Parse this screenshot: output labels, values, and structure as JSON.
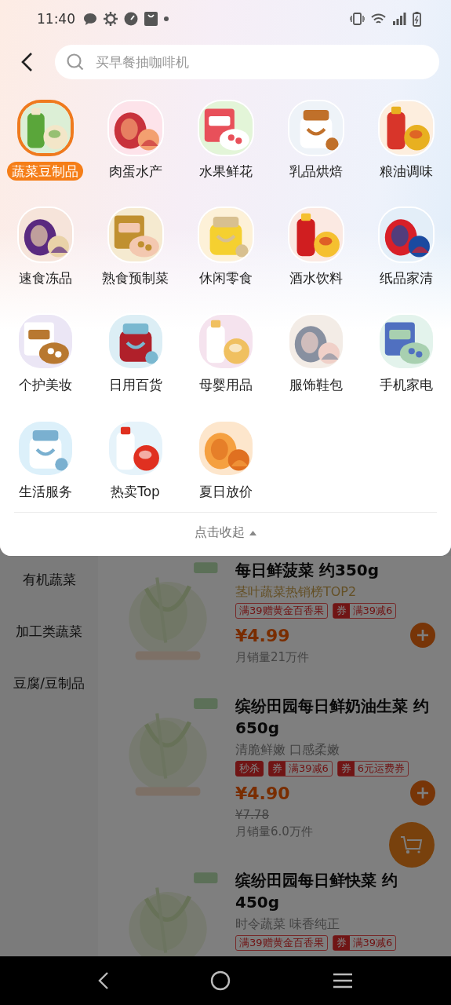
{
  "status_bar": {
    "time": "11:40"
  },
  "search": {
    "placeholder": "买早餐抽咖啡机"
  },
  "categories": [
    {
      "label": "蔬菜豆制品",
      "selected": true
    },
    {
      "label": "肉蛋水产",
      "selected": false
    },
    {
      "label": "水果鲜花",
      "selected": false
    },
    {
      "label": "乳品烘焙",
      "selected": false
    },
    {
      "label": "粮油调味",
      "selected": false
    },
    {
      "label": "速食冻品",
      "selected": false
    },
    {
      "label": "熟食预制菜",
      "selected": false
    },
    {
      "label": "休闲零食",
      "selected": false
    },
    {
      "label": "酒水饮料",
      "selected": false
    },
    {
      "label": "纸品家清",
      "selected": false
    },
    {
      "label": "个护美妆",
      "selected": false
    },
    {
      "label": "日用百货",
      "selected": false
    },
    {
      "label": "母婴用品",
      "selected": false
    },
    {
      "label": "服饰鞋包",
      "selected": false
    },
    {
      "label": "手机家电",
      "selected": false
    },
    {
      "label": "生活服务",
      "selected": false
    },
    {
      "label": "热卖Top",
      "selected": false
    },
    {
      "label": "夏日放价",
      "selected": false
    }
  ],
  "collapse_label": "点击收起",
  "sidebar": {
    "items": [
      {
        "label": "有机蔬菜",
        "selected": false
      },
      {
        "label": "加工类蔬菜",
        "selected": false
      },
      {
        "label": "豆腐/豆制品",
        "selected": false
      }
    ]
  },
  "products": [
    {
      "title": "每日鲜菠菜 约350g",
      "subtitle": "茎叶蔬菜热销榜TOP2",
      "subtitle_highlight": true,
      "tags": [
        {
          "kind": "gift",
          "text": "满39赠黄金百香果"
        },
        {
          "kind": "coupon",
          "mark": "券",
          "text": "满39减6"
        }
      ],
      "price": "¥4.99",
      "sales": "月销量21万件"
    },
    {
      "title": "缤纷田园每日鲜奶油生菜 约650g",
      "subtitle": "清脆鲜嫩  口感柔嫩",
      "subtitle_highlight": false,
      "tags": [
        {
          "kind": "flash",
          "text": "秒杀"
        },
        {
          "kind": "coupon",
          "mark": "券",
          "text": "满39减6"
        },
        {
          "kind": "coupon",
          "mark": "券",
          "text": "6元运费券"
        }
      ],
      "price": "¥4.90",
      "old_price": "¥7.78",
      "sales": "月销量6.0万件"
    },
    {
      "title": "缤纷田园每日鲜快菜 约450g",
      "subtitle": "时令蔬菜 味香纯正",
      "subtitle_highlight": false,
      "tags": [
        {
          "kind": "gift",
          "text": "满39赠黄金百香果"
        },
        {
          "kind": "coupon",
          "mark": "券",
          "text": "满39减6"
        }
      ]
    }
  ]
}
